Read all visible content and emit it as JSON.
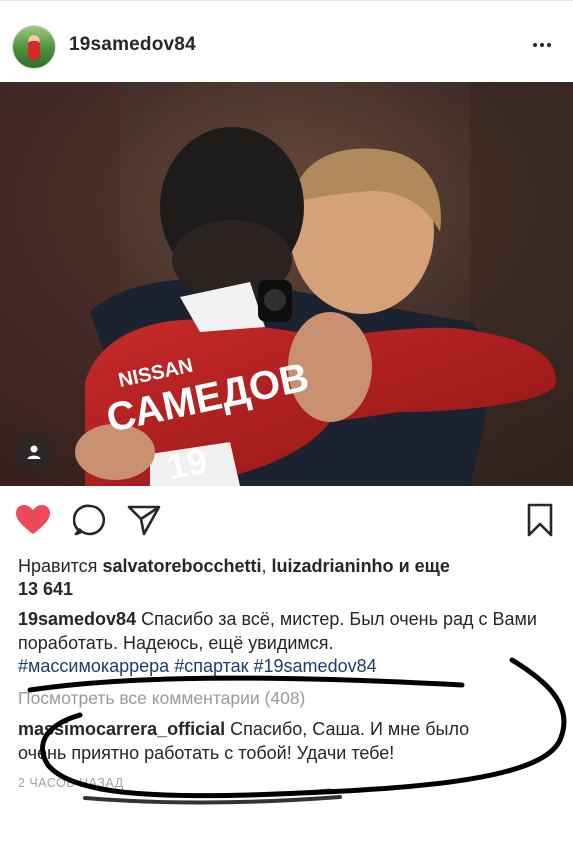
{
  "post": {
    "username": "19samedov84",
    "photo": {
      "jersey_sponsor": "NISSAN",
      "jersey_name": "САМЕДОВ",
      "jersey_number": "19"
    }
  },
  "likes": {
    "prefix": "Нравится",
    "user1": "salvatorebocchetti",
    "sep": ",",
    "user2": "luizadrianinho",
    "conj": "и еще",
    "count": "13 641"
  },
  "caption": {
    "username": "19samedov84",
    "text": "Спасибо за всё, мистер. Был очень рад с Вами поработать. Надеюсь, ещё увидимся.",
    "hashtags": [
      "#массимокаррера",
      "#спартак",
      "#19samedov84"
    ]
  },
  "comments": {
    "view_all": "Посмотреть все комментарии (408)",
    "items": [
      {
        "username": "massimocarrera_official",
        "text": "Спасибо, Саша. И мне было очень приятно работать с тобой! Удачи тебе!"
      }
    ]
  },
  "timestamp": "2 ЧАСОВ НАЗАД",
  "colors": {
    "heart": "#ed4956",
    "hashtag": "#173e73",
    "muted": "#9a9a9a",
    "scribble": "#000000"
  },
  "icons": [
    "more-options-icon",
    "user-tag-icon",
    "heart-icon",
    "comment-icon",
    "share-icon",
    "bookmark-icon"
  ]
}
